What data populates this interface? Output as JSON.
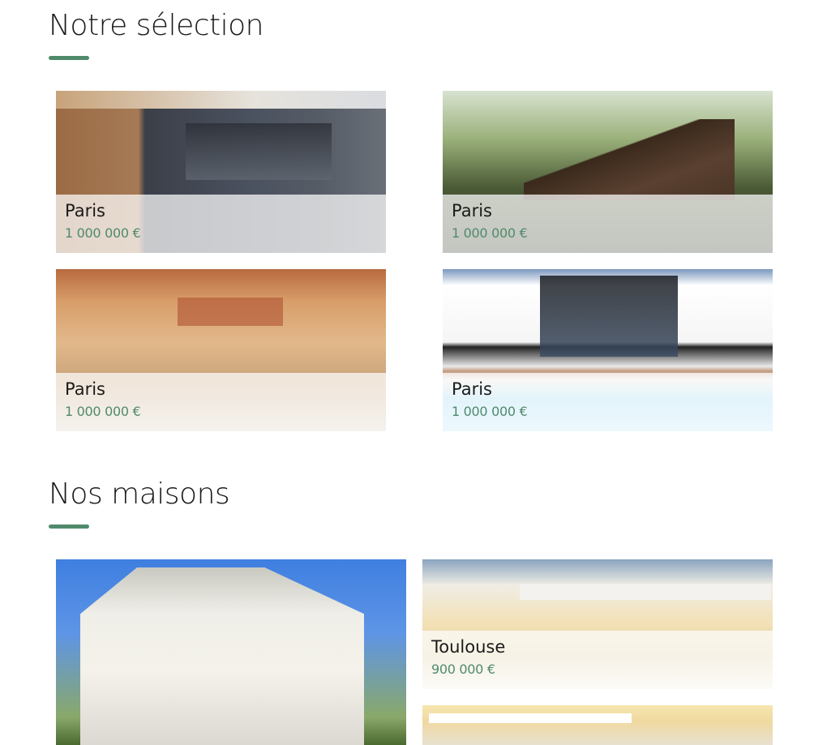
{
  "sections": {
    "selection": {
      "title": "Notre sélection",
      "cards": [
        {
          "city": "Paris",
          "price": "1 000 000 €"
        },
        {
          "city": "Paris",
          "price": "1 000 000 €"
        },
        {
          "city": "Paris",
          "price": "1 000 000 €"
        },
        {
          "city": "Paris",
          "price": "1 000 000 €"
        }
      ]
    },
    "houses": {
      "title": "Nos maisons",
      "cards": [
        {
          "city": "Toulouse",
          "price": "900 000 €"
        }
      ]
    }
  },
  "colors": {
    "accent": "#4f8a6b",
    "text": "#1a1a1a",
    "background": "#ffffff"
  }
}
